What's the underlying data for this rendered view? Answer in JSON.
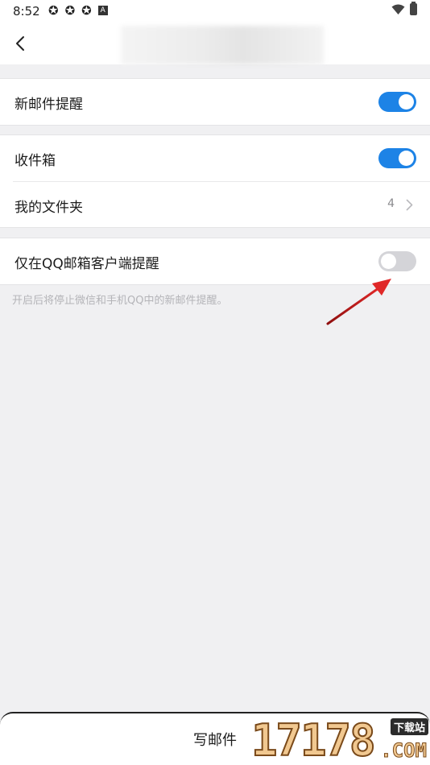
{
  "status_bar": {
    "time": "8:52",
    "notification_icons": [
      "sync-icon",
      "sync-icon",
      "sync-icon",
      "a-icon"
    ],
    "a_badge": "A"
  },
  "header": {
    "back_icon": "chevron-left-icon"
  },
  "settings": {
    "new_mail_alert": {
      "label": "新邮件提醒",
      "enabled": true
    },
    "inbox": {
      "label": "收件箱",
      "enabled": true
    },
    "my_folders": {
      "label": "我的文件夹",
      "count": "4"
    },
    "qq_client_only": {
      "label": "仅在QQ邮箱客户端提醒",
      "enabled": false
    },
    "hint": "开启后将停止微信和手机QQ中的新邮件提醒。"
  },
  "compose": {
    "label": "写邮件"
  },
  "watermark": {
    "digits": "17178",
    "badge": "下载站",
    "domain": ".COM"
  },
  "colors": {
    "accent": "#1d83e6",
    "toggle_off": "#d4d4d8",
    "annotation_arrow": "#d81e1e"
  }
}
